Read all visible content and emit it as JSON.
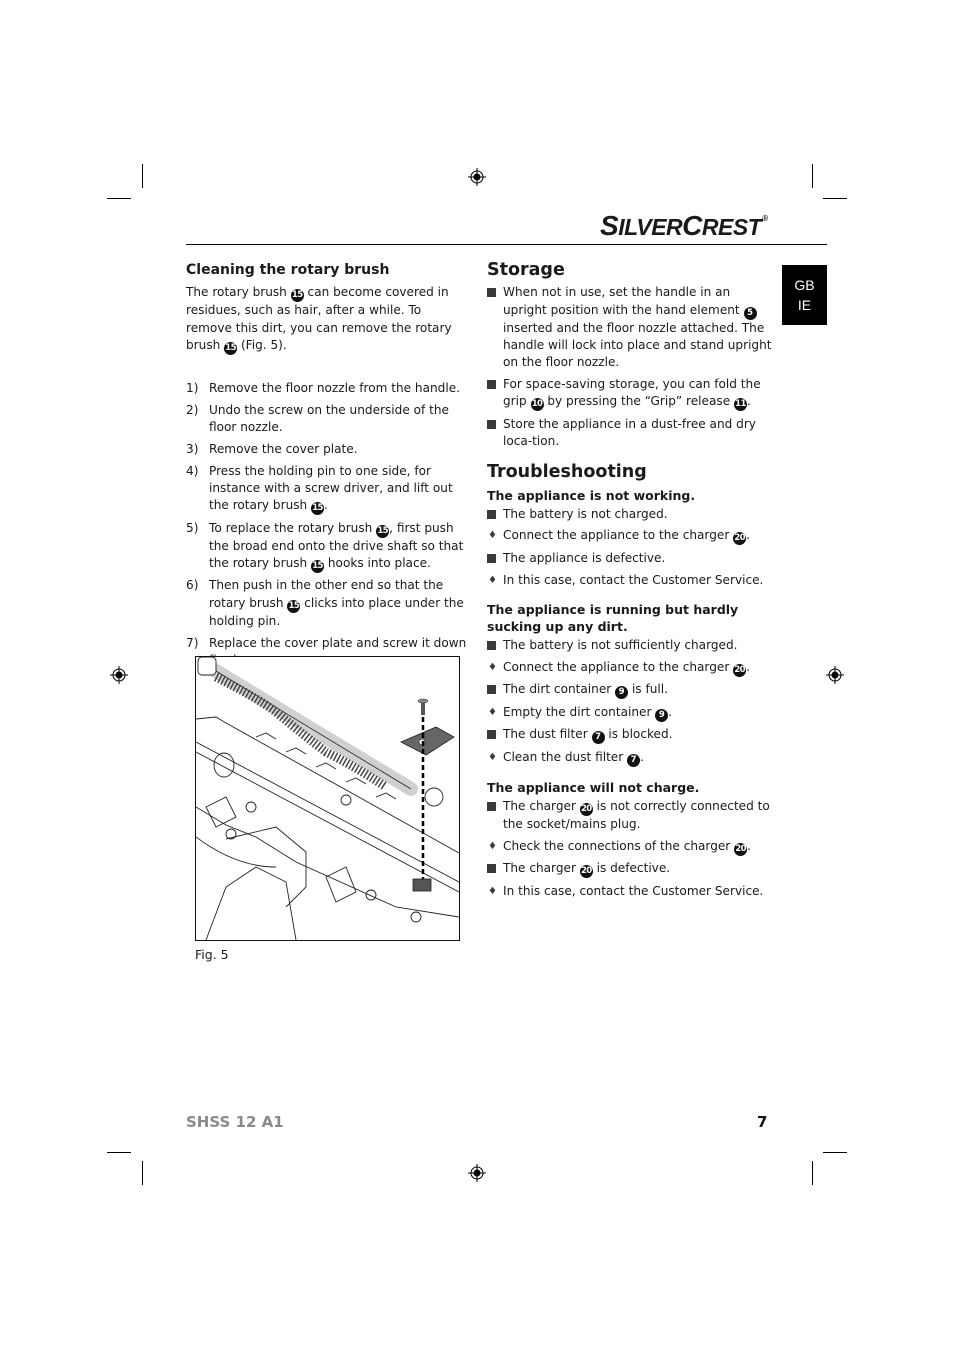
{
  "brand": {
    "logo_s": "S",
    "logo_ilver": "ILVER",
    "logo_c": "C",
    "logo_rest": "REST",
    "registered": "®"
  },
  "language_tab": {
    "line1": "GB",
    "line2": "IE"
  },
  "left": {
    "heading": "Cleaning the rotary brush",
    "intro": [
      {
        "t": "The rotary brush "
      },
      {
        "ref": "15"
      },
      {
        "t": " can become covered in residues, such as hair, after a while. To remove this dirt, you can remove the rotary brush "
      },
      {
        "ref": "15"
      },
      {
        "t": " (Fig. 5)."
      }
    ],
    "steps": [
      {
        "num": "1)",
        "parts": [
          {
            "t": "Remove the floor nozzle from the handle."
          }
        ]
      },
      {
        "num": "2)",
        "parts": [
          {
            "t": "Undo the screw on the underside of the floor nozzle."
          }
        ]
      },
      {
        "num": "3)",
        "parts": [
          {
            "t": "Remove the cover plate."
          }
        ]
      },
      {
        "num": "4)",
        "parts": [
          {
            "t": "Press the holding pin to one side, for instance with a screw driver, and lift out the rotary brush "
          },
          {
            "ref": "15"
          },
          {
            "t": "."
          }
        ]
      },
      {
        "num": "5)",
        "parts": [
          {
            "t": "To replace the rotary brush "
          },
          {
            "ref": "15"
          },
          {
            "t": ", first push the broad end onto the drive shaft so that the rotary brush "
          },
          {
            "ref": "15"
          },
          {
            "t": " hooks into place."
          }
        ]
      },
      {
        "num": "6)",
        "parts": [
          {
            "t": "Then push in the other end so that the rotary brush "
          },
          {
            "ref": "15"
          },
          {
            "t": " clicks into place under the holding pin."
          }
        ]
      },
      {
        "num": "7)",
        "parts": [
          {
            "t": "Replace the cover plate and screw it down firmly."
          }
        ]
      }
    ],
    "figure_caption": "Fig. 5"
  },
  "storage": {
    "heading": "Storage",
    "items": [
      {
        "type": "square",
        "parts": [
          {
            "t": "When not in use, set the handle in an upright position with the hand element "
          },
          {
            "ref": "5"
          },
          {
            "t": " inserted and the floor nozzle attached. The handle will lock into place and stand upright on the floor nozzle."
          }
        ]
      },
      {
        "type": "square",
        "parts": [
          {
            "t": "For space-saving storage, you can fold the grip "
          },
          {
            "ref": "10"
          },
          {
            "t": " by pressing the “Grip” release "
          },
          {
            "ref": "11"
          },
          {
            "t": "."
          }
        ]
      },
      {
        "type": "square",
        "parts": [
          {
            "t": "Store the appliance in a dust-free and dry loca-tion."
          }
        ]
      }
    ]
  },
  "troubleshooting": {
    "heading": "Troubleshooting",
    "sections": [
      {
        "title": "The appliance is not working.",
        "items": [
          {
            "type": "square",
            "parts": [
              {
                "t": "The battery is not charged."
              }
            ]
          },
          {
            "type": "diamond",
            "parts": [
              {
                "t": "Connect the appliance to the charger "
              },
              {
                "ref": "20"
              },
              {
                "t": "."
              }
            ]
          },
          {
            "type": "square",
            "parts": [
              {
                "t": "The appliance is defective."
              }
            ]
          },
          {
            "type": "diamond",
            "parts": [
              {
                "t": "In this case, contact the Customer Service."
              }
            ]
          }
        ]
      },
      {
        "title": "The appliance is running but hardly sucking up any dirt.",
        "items": [
          {
            "type": "square",
            "parts": [
              {
                "t": "The battery is not sufficiently charged."
              }
            ]
          },
          {
            "type": "diamond",
            "parts": [
              {
                "t": "Connect the appliance to the charger "
              },
              {
                "ref": "20"
              },
              {
                "t": "."
              }
            ]
          },
          {
            "type": "square",
            "parts": [
              {
                "t": "The dirt container "
              },
              {
                "ref": "9"
              },
              {
                "t": " is full."
              }
            ]
          },
          {
            "type": "diamond",
            "parts": [
              {
                "t": "Empty the dirt container "
              },
              {
                "ref": "9"
              },
              {
                "t": "."
              }
            ]
          },
          {
            "type": "square",
            "parts": [
              {
                "t": "The dust filter "
              },
              {
                "ref": "7"
              },
              {
                "t": " is blocked."
              }
            ]
          },
          {
            "type": "diamond",
            "parts": [
              {
                "t": "Clean the dust filter "
              },
              {
                "ref": "7"
              },
              {
                "t": "."
              }
            ]
          }
        ]
      },
      {
        "title": "The appliance will not charge.",
        "items": [
          {
            "type": "square",
            "parts": [
              {
                "t": "The charger "
              },
              {
                "ref": "20"
              },
              {
                "t": " is not correctly connected to the socket/mains plug."
              }
            ]
          },
          {
            "type": "diamond",
            "parts": [
              {
                "t": "Check the connections of the charger "
              },
              {
                "ref": "20"
              },
              {
                "t": "."
              }
            ]
          },
          {
            "type": "square",
            "parts": [
              {
                "t": "The charger "
              },
              {
                "ref": "20"
              },
              {
                "t": " is defective."
              }
            ]
          },
          {
            "type": "diamond",
            "parts": [
              {
                "t": "In this case, contact the Customer Service."
              }
            ]
          }
        ]
      }
    ]
  },
  "footer": {
    "model": "SHSS 12 A1",
    "page_number": "7"
  },
  "colors": {
    "text": "#1a1a1a",
    "footer_model": "#8a8a8a",
    "tab_bg": "#000000",
    "bullet": "#3a3a3a"
  }
}
